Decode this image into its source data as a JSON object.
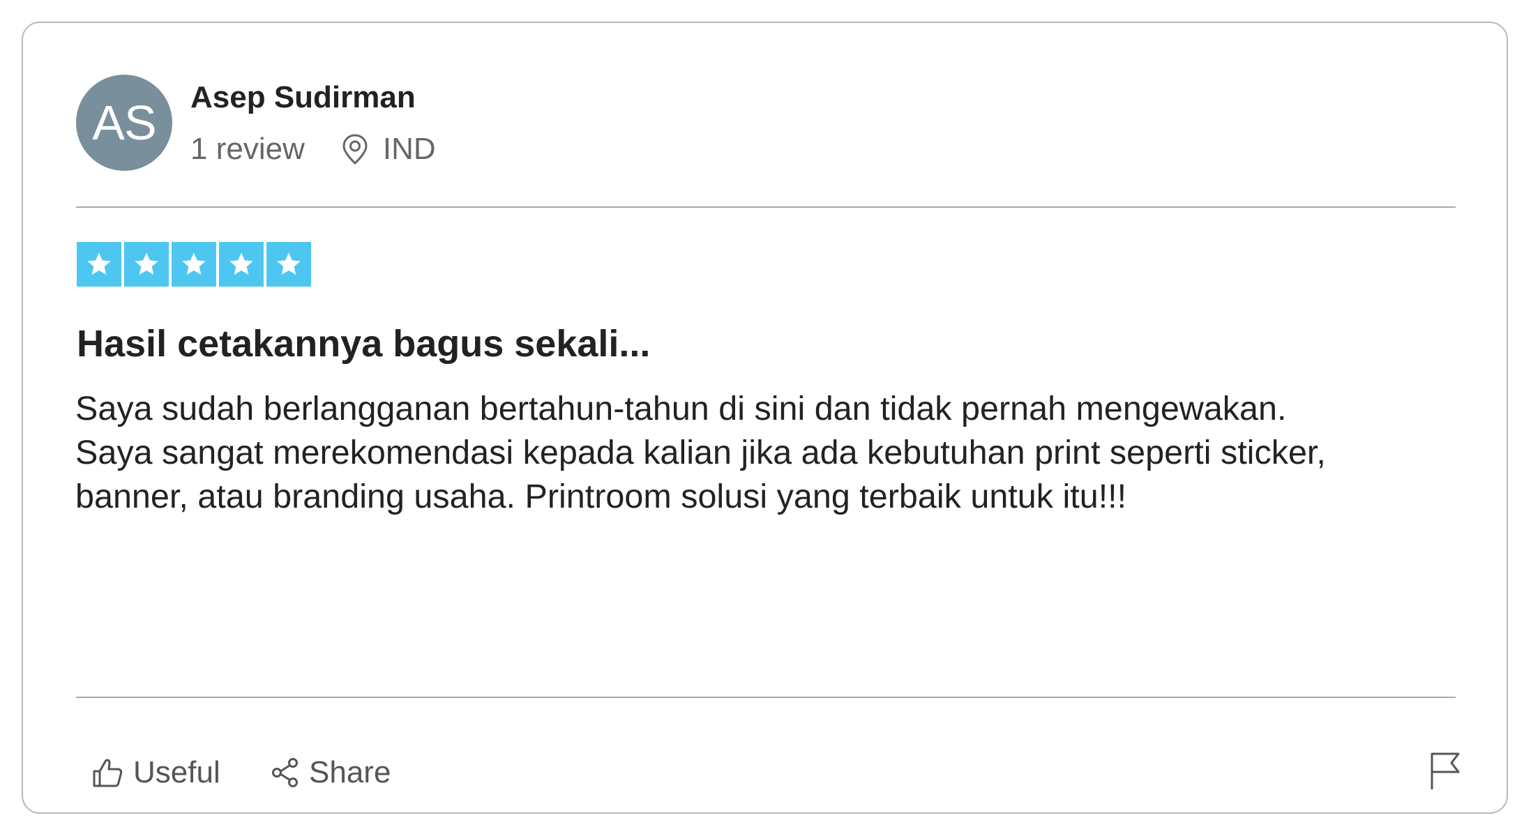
{
  "author": {
    "initials": "AS",
    "name": "Asep Sudirman",
    "review_count": "1 review",
    "location": "IND"
  },
  "review": {
    "rating": 5,
    "max_rating": 5,
    "title": "Hasil cetakannya bagus sekali...",
    "body_lines": [
      "Saya sudah berlangganan bertahun-tahun di sini dan tidak pernah mengewakan.",
      "Saya sangat merekomendasi kepada kalian jika ada kebutuhan print seperti sticker,",
      "banner, atau branding usaha. Printroom solusi yang terbaik untuk itu!!!"
    ]
  },
  "actions": {
    "useful_label": "Useful",
    "share_label": "Share"
  },
  "icons": {
    "location": "location-pin-icon",
    "star": "star-icon",
    "useful": "thumbs-up-icon",
    "share": "share-icon",
    "report": "flag-icon"
  },
  "colors": {
    "avatar_bg": "#798f9b",
    "star_bg": "#4dc6f2",
    "text_primary": "#222222",
    "text_secondary": "#666666",
    "border": "#b8b8b8"
  }
}
